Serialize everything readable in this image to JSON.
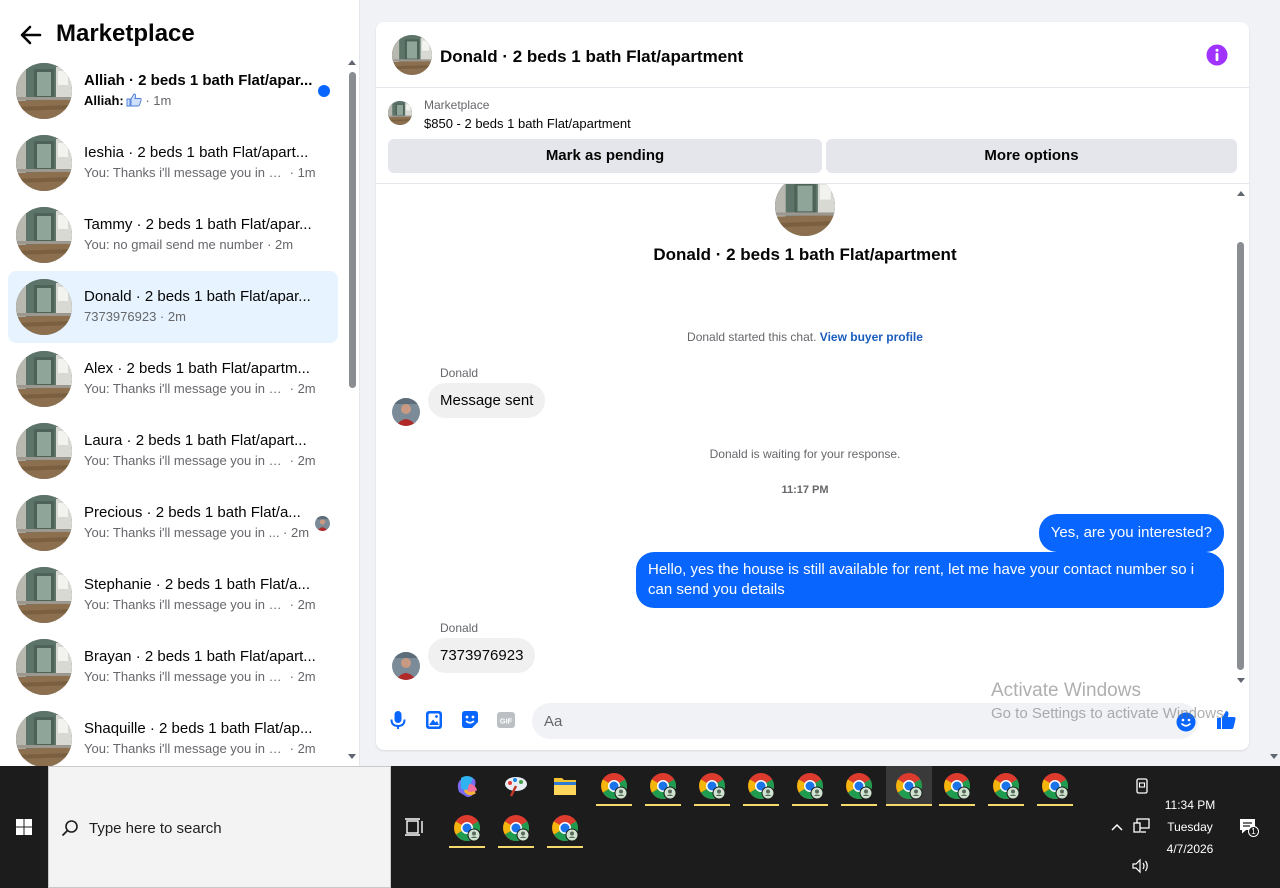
{
  "left_panel": {
    "title": "Marketplace",
    "conversations": [
      {
        "name": "Alliah · 2 beds 1 bath Flat/apar...",
        "preview_prefix": "Alliah:",
        "preview": "",
        "time": "1m",
        "unread": true,
        "indicator": "unread-dot",
        "preview_icon": "like-thumb-icon"
      },
      {
        "name": "Ieshia · 2 beds 1 bath Flat/apart...",
        "preview": "You: Thanks i'll message you in a ...",
        "time": "1m",
        "unread": false
      },
      {
        "name": "Tammy · 2 beds 1 bath Flat/apar...",
        "preview": "You: no gmail send me number",
        "time": "2m",
        "unread": false
      },
      {
        "name": "Donald · 2 beds 1 bath Flat/apar...",
        "preview": "7373976923",
        "time": "2m",
        "unread": false,
        "active": true
      },
      {
        "name": "Alex · 2 beds 1 bath Flat/apartm...",
        "preview": "You: Thanks i'll message you in a ...",
        "time": "2m",
        "unread": false
      },
      {
        "name": "Laura · 2 beds 1 bath Flat/apart...",
        "preview": "You: Thanks i'll message you in a ...",
        "time": "2m",
        "unread": false
      },
      {
        "name": "Precious · 2 beds 1 bath Flat/a...",
        "preview": "You: Thanks i'll message you in ...",
        "time": "2m",
        "unread": false,
        "indicator": "seen-avatar"
      },
      {
        "name": "Stephanie · 2 beds 1 bath Flat/a...",
        "preview": "You: Thanks i'll message you in a ...",
        "time": "2m",
        "unread": false
      },
      {
        "name": "Brayan · 2 beds 1 bath Flat/apart...",
        "preview": "You: Thanks i'll message you in a ...",
        "time": "2m",
        "unread": false
      },
      {
        "name": "Shaquille · 2 beds 1 bath Flat/ap...",
        "preview": "You: Thanks i'll message you in a ...",
        "time": "2m",
        "unread": false
      }
    ]
  },
  "chat": {
    "header_title": "Donald · 2 beds 1 bath Flat/apartment",
    "marketplace_label": "Marketplace",
    "listing": "$850 - 2 beds 1 bath Flat/apartment",
    "mark_pending_label": "Mark as pending",
    "more_options_label": "More options",
    "thread_title": "Donald · 2 beds 1 bath Flat/apartment",
    "started_text": "Donald started this chat.",
    "view_profile_link": "View buyer profile",
    "sender_name": "Donald",
    "msg1": "Message sent",
    "waiting_text": "Donald is waiting for your response.",
    "timestamp": "11:17 PM",
    "out1": "Yes, are you interested?",
    "out2": "Hello, yes the house is still available for rent, let me have your contact number so i can send you details",
    "sender_name2": "Donald",
    "msg2": "7373976923",
    "input_placeholder": "Aa"
  },
  "watermark": {
    "line1": "Activate Windows",
    "line2": "Go to Settings to activate Windows."
  },
  "taskbar": {
    "search_placeholder": "Type here to search",
    "time": "11:34 PM",
    "day": "Tuesday",
    "date": "4/7/2026",
    "notification_count": "1"
  },
  "colors": {
    "accent": "#0866ff",
    "info_purple": "#a033ff",
    "active_row": "#e7f3ff"
  }
}
